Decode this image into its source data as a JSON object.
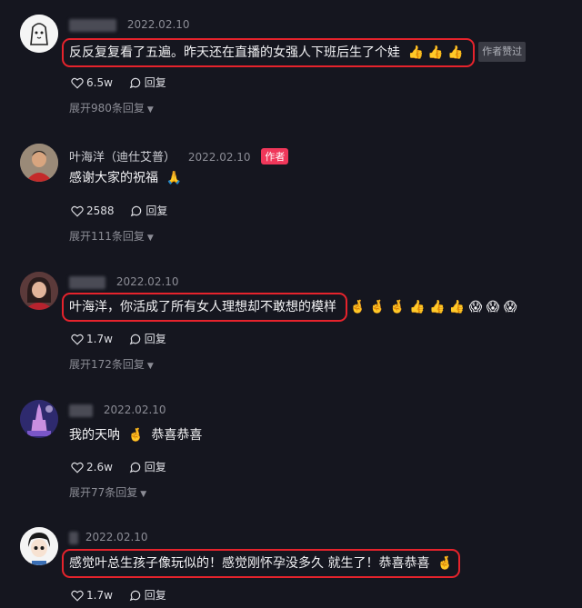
{
  "comments": [
    {
      "date": "2022.02.10",
      "text": "反反复复看了五遍。昨天还在直播的女强人下班后生了个娃",
      "emojis": "👍 👍 👍",
      "tag": "作者赞过",
      "likes": "6.5w",
      "reply_label": "回复",
      "expand": "展开980条回复"
    },
    {
      "author": "叶海洋（迪仕艾普）",
      "date": "2022.02.10",
      "badge": "作者",
      "text": "感谢大家的祝福",
      "emojis": "🙏",
      "likes": "2588",
      "reply_label": "回复",
      "expand": "展开111条回复"
    },
    {
      "date": "2022.02.10",
      "text": "叶海洋，你活成了所有女人理想却不敢想的模样",
      "emojis": "🤞 🤞 🤞 👍 👍 👍 😱 😱 😱",
      "likes": "1.7w",
      "reply_label": "回复",
      "expand": "展开172条回复"
    },
    {
      "date": "2022.02.10",
      "text": "我的天呐",
      "emojis": "🤞",
      "text2": "恭喜恭喜",
      "likes": "2.6w",
      "reply_label": "回复",
      "expand": "展开77条回复"
    },
    {
      "date": "2022.02.10",
      "text": "感觉叶总生孩子像玩似的！感觉刚怀孕没多久 就生了！恭喜恭喜",
      "emojis": "🤞",
      "likes": "1.7w",
      "reply_label": "回复"
    }
  ]
}
